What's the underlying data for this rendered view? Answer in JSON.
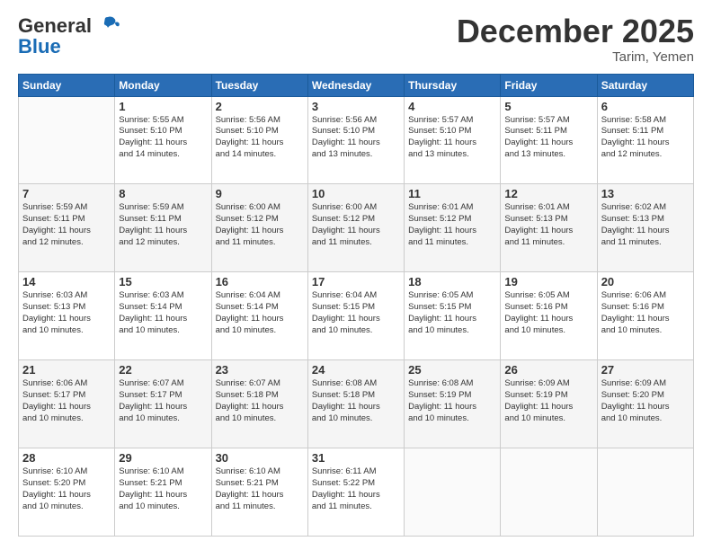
{
  "header": {
    "logo_general": "General",
    "logo_blue": "Blue",
    "month_title": "December 2025",
    "location": "Tarim, Yemen"
  },
  "calendar": {
    "days_of_week": [
      "Sunday",
      "Monday",
      "Tuesday",
      "Wednesday",
      "Thursday",
      "Friday",
      "Saturday"
    ],
    "weeks": [
      [
        {
          "day": "",
          "info": ""
        },
        {
          "day": "1",
          "info": "Sunrise: 5:55 AM\nSunset: 5:10 PM\nDaylight: 11 hours\nand 14 minutes."
        },
        {
          "day": "2",
          "info": "Sunrise: 5:56 AM\nSunset: 5:10 PM\nDaylight: 11 hours\nand 14 minutes."
        },
        {
          "day": "3",
          "info": "Sunrise: 5:56 AM\nSunset: 5:10 PM\nDaylight: 11 hours\nand 13 minutes."
        },
        {
          "day": "4",
          "info": "Sunrise: 5:57 AM\nSunset: 5:10 PM\nDaylight: 11 hours\nand 13 minutes."
        },
        {
          "day": "5",
          "info": "Sunrise: 5:57 AM\nSunset: 5:11 PM\nDaylight: 11 hours\nand 13 minutes."
        },
        {
          "day": "6",
          "info": "Sunrise: 5:58 AM\nSunset: 5:11 PM\nDaylight: 11 hours\nand 12 minutes."
        }
      ],
      [
        {
          "day": "7",
          "info": "Sunrise: 5:59 AM\nSunset: 5:11 PM\nDaylight: 11 hours\nand 12 minutes."
        },
        {
          "day": "8",
          "info": "Sunrise: 5:59 AM\nSunset: 5:11 PM\nDaylight: 11 hours\nand 12 minutes."
        },
        {
          "day": "9",
          "info": "Sunrise: 6:00 AM\nSunset: 5:12 PM\nDaylight: 11 hours\nand 11 minutes."
        },
        {
          "day": "10",
          "info": "Sunrise: 6:00 AM\nSunset: 5:12 PM\nDaylight: 11 hours\nand 11 minutes."
        },
        {
          "day": "11",
          "info": "Sunrise: 6:01 AM\nSunset: 5:12 PM\nDaylight: 11 hours\nand 11 minutes."
        },
        {
          "day": "12",
          "info": "Sunrise: 6:01 AM\nSunset: 5:13 PM\nDaylight: 11 hours\nand 11 minutes."
        },
        {
          "day": "13",
          "info": "Sunrise: 6:02 AM\nSunset: 5:13 PM\nDaylight: 11 hours\nand 11 minutes."
        }
      ],
      [
        {
          "day": "14",
          "info": "Sunrise: 6:03 AM\nSunset: 5:13 PM\nDaylight: 11 hours\nand 10 minutes."
        },
        {
          "day": "15",
          "info": "Sunrise: 6:03 AM\nSunset: 5:14 PM\nDaylight: 11 hours\nand 10 minutes."
        },
        {
          "day": "16",
          "info": "Sunrise: 6:04 AM\nSunset: 5:14 PM\nDaylight: 11 hours\nand 10 minutes."
        },
        {
          "day": "17",
          "info": "Sunrise: 6:04 AM\nSunset: 5:15 PM\nDaylight: 11 hours\nand 10 minutes."
        },
        {
          "day": "18",
          "info": "Sunrise: 6:05 AM\nSunset: 5:15 PM\nDaylight: 11 hours\nand 10 minutes."
        },
        {
          "day": "19",
          "info": "Sunrise: 6:05 AM\nSunset: 5:16 PM\nDaylight: 11 hours\nand 10 minutes."
        },
        {
          "day": "20",
          "info": "Sunrise: 6:06 AM\nSunset: 5:16 PM\nDaylight: 11 hours\nand 10 minutes."
        }
      ],
      [
        {
          "day": "21",
          "info": "Sunrise: 6:06 AM\nSunset: 5:17 PM\nDaylight: 11 hours\nand 10 minutes."
        },
        {
          "day": "22",
          "info": "Sunrise: 6:07 AM\nSunset: 5:17 PM\nDaylight: 11 hours\nand 10 minutes."
        },
        {
          "day": "23",
          "info": "Sunrise: 6:07 AM\nSunset: 5:18 PM\nDaylight: 11 hours\nand 10 minutes."
        },
        {
          "day": "24",
          "info": "Sunrise: 6:08 AM\nSunset: 5:18 PM\nDaylight: 11 hours\nand 10 minutes."
        },
        {
          "day": "25",
          "info": "Sunrise: 6:08 AM\nSunset: 5:19 PM\nDaylight: 11 hours\nand 10 minutes."
        },
        {
          "day": "26",
          "info": "Sunrise: 6:09 AM\nSunset: 5:19 PM\nDaylight: 11 hours\nand 10 minutes."
        },
        {
          "day": "27",
          "info": "Sunrise: 6:09 AM\nSunset: 5:20 PM\nDaylight: 11 hours\nand 10 minutes."
        }
      ],
      [
        {
          "day": "28",
          "info": "Sunrise: 6:10 AM\nSunset: 5:20 PM\nDaylight: 11 hours\nand 10 minutes."
        },
        {
          "day": "29",
          "info": "Sunrise: 6:10 AM\nSunset: 5:21 PM\nDaylight: 11 hours\nand 10 minutes."
        },
        {
          "day": "30",
          "info": "Sunrise: 6:10 AM\nSunset: 5:21 PM\nDaylight: 11 hours\nand 11 minutes."
        },
        {
          "day": "31",
          "info": "Sunrise: 6:11 AM\nSunset: 5:22 PM\nDaylight: 11 hours\nand 11 minutes."
        },
        {
          "day": "",
          "info": ""
        },
        {
          "day": "",
          "info": ""
        },
        {
          "day": "",
          "info": ""
        }
      ]
    ]
  }
}
